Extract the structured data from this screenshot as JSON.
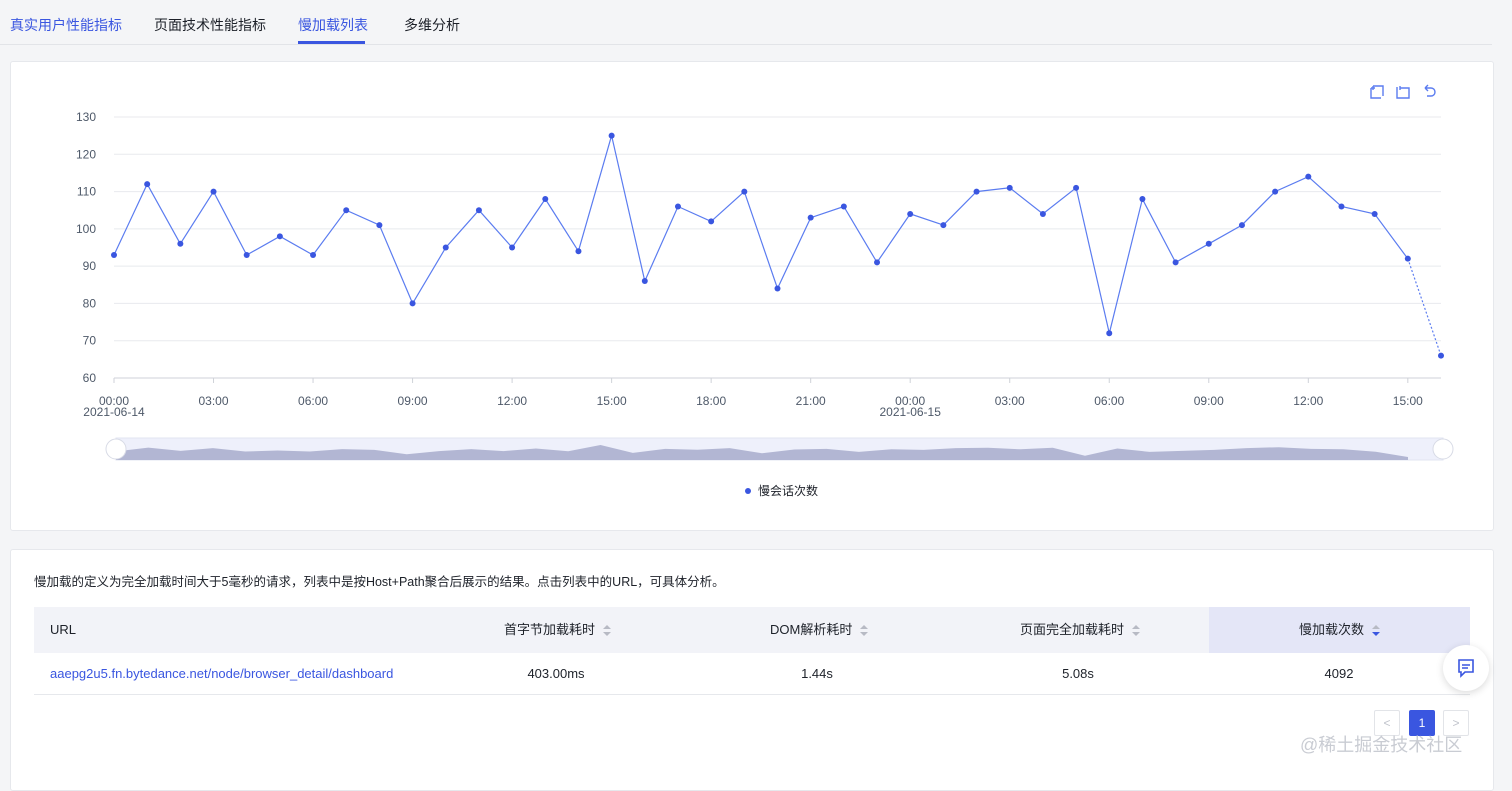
{
  "tabs": [
    {
      "label": "真实用户性能指标"
    },
    {
      "label": "页面技术性能指标"
    },
    {
      "label": "慢加载列表"
    },
    {
      "label": "多维分析"
    }
  ],
  "toolbox": {
    "icons": [
      "zoom-area-icon",
      "zoom-reset-icon",
      "restore-icon"
    ]
  },
  "chart_data": {
    "type": "line",
    "title": "",
    "xlabel": "",
    "ylabel": "",
    "ylim": [
      60,
      130
    ],
    "yticks": [
      "60",
      "70",
      "80",
      "90",
      "100",
      "110",
      "120",
      "130"
    ],
    "x_tick_labels": [
      {
        "time": "00:00",
        "date": "2021-06-14"
      },
      {
        "time": "03:00"
      },
      {
        "time": "06:00"
      },
      {
        "time": "09:00"
      },
      {
        "time": "12:00"
      },
      {
        "time": "15:00"
      },
      {
        "time": "18:00"
      },
      {
        "time": "21:00"
      },
      {
        "time": "00:00",
        "date": "2021-06-15"
      },
      {
        "time": "03:00"
      },
      {
        "time": "06:00"
      },
      {
        "time": "09:00"
      },
      {
        "time": "12:00"
      },
      {
        "time": "15:00"
      }
    ],
    "x_start": "2021-06-14 00:00",
    "x_step_hours": 1,
    "series": [
      {
        "name": "慢会话次数",
        "color": "#5b7cf0",
        "values": [
          93,
          112,
          96,
          110,
          93,
          98,
          93,
          105,
          101,
          80,
          95,
          105,
          95,
          108,
          94,
          125,
          86,
          106,
          102,
          110,
          84,
          103,
          106,
          91,
          104,
          101,
          110,
          111,
          104,
          111,
          72,
          108,
          91,
          96,
          101,
          110,
          114,
          106,
          104,
          92,
          66
        ]
      }
    ],
    "last_segment_dashed": true,
    "grid": true,
    "legend": "bottom-center",
    "data_zoom": true
  },
  "legend": {
    "label": "慢会话次数"
  },
  "table": {
    "description": "慢加载的定义为完全加载时间大于5毫秒的请求，列表中是按Host+Path聚合后展示的结果。点击列表中的URL，可具体分析。",
    "columns": [
      "URL",
      "首字节加载耗时",
      "DOM解析耗时",
      "页面完全加载耗时",
      "慢加载次数"
    ],
    "rows": [
      {
        "url": "aaepg2u5.fn.bytedance.net/node/browser_detail/dashboard",
        "ttfb": "403.00ms",
        "dom": "1.44s",
        "full": "5.08s",
        "count": "4092"
      }
    ]
  },
  "pagination": {
    "prev": "<",
    "current": "1",
    "next": ">"
  },
  "watermark": "@稀土掘金技术社区"
}
